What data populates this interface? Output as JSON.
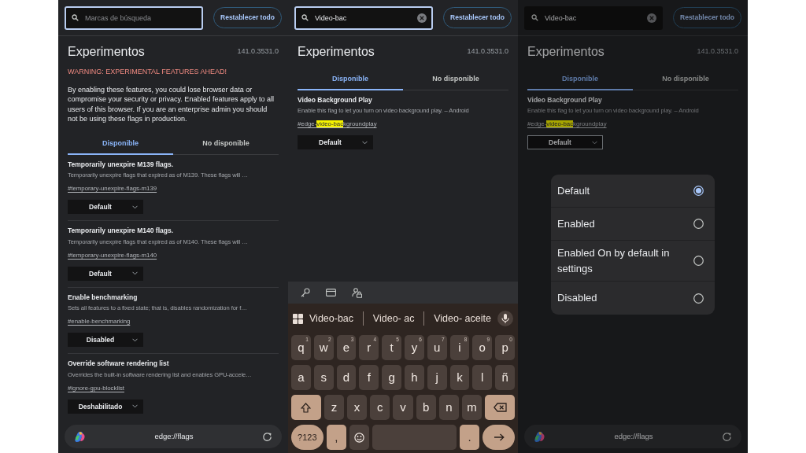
{
  "screens": [
    {
      "dimmed": false,
      "search": {
        "placeholder": "Marcas de búsqueda",
        "focused": true
      },
      "reset_button": "Restablecer todo",
      "title": "Experimentos",
      "version": "141.0.3531.0",
      "warning": "WARNING: EXPERIMENTAL FEATURES AHEAD!",
      "intro": "By enabling these features, you could lose browser data or compromise your security or privacy. Enabled features apply to all users of this browser. If you are an enterprise admin you should not be using these flags in production.",
      "tabs": [
        {
          "label": "Disponible",
          "selected": true
        },
        {
          "label": "No disponible",
          "selected": false
        }
      ],
      "flags": [
        {
          "name": "Temporarily unexpire M139 flags.",
          "description": "Temporarily unexpire flags that expired as of M139. These flags will …",
          "link": [
            {
              "text": "#temporary-unexpire-flags-m139",
              "highlighted": false
            }
          ],
          "value": "Default",
          "focused": false
        },
        {
          "name": "Temporarily unexpire M140 flags.",
          "description": "Temporarily unexpire flags that expired as of M140. These flags will …",
          "link": [
            {
              "text": "#temporary-unexpire-flags-m140",
              "highlighted": false
            }
          ],
          "value": "Default",
          "focused": false
        },
        {
          "name": "Enable benchmarking",
          "description": "Sets all features to a fixed state; that is, disables randomization for f…",
          "link": [
            {
              "text": "#enable-benchmarking",
              "highlighted": false
            }
          ],
          "value": "Disabled",
          "focused": false
        },
        {
          "name": "Override software rendering list",
          "description": "Overrides the built-in software rendering list and enables GPU-accele…",
          "link": [
            {
              "text": "#ignore-gpu-blocklist",
              "highlighted": false
            }
          ],
          "value": "Deshabilitado",
          "focused": false
        }
      ],
      "address_bar": {
        "url": "edge://flags"
      }
    },
    {
      "dimmed": false,
      "search": {
        "value": "Video-bac",
        "focused": true
      },
      "reset_button": "Restablecer todo",
      "title": "Experimentos",
      "version": "141.0.3531.0",
      "tabs": [
        {
          "label": "Disponible",
          "selected": true
        },
        {
          "label": "No disponible",
          "selected": false
        }
      ],
      "flags": [
        {
          "name": "Video Background Play",
          "description": "Enable this flag to let you turn on video background play. – Android",
          "link": [
            {
              "text": "#edge-",
              "highlighted": false
            },
            {
              "text": "video-bac",
              "highlighted": true
            },
            {
              "text": "kgroundplay",
              "highlighted": false
            }
          ],
          "value": "Default",
          "focused": false
        }
      ],
      "keyboard": {
        "suggestions": [
          "Video-bac",
          "Video- ac",
          "Video- aceite"
        ],
        "rows": [
          [
            {
              "kind": "letter",
              "label": "q",
              "hint": "1"
            },
            {
              "kind": "letter",
              "label": "w",
              "hint": "2"
            },
            {
              "kind": "letter",
              "label": "e",
              "hint": "3"
            },
            {
              "kind": "letter",
              "label": "r",
              "hint": "4"
            },
            {
              "kind": "letter",
              "label": "t",
              "hint": "5"
            },
            {
              "kind": "letter",
              "label": "y",
              "hint": "6"
            },
            {
              "kind": "letter",
              "label": "u",
              "hint": "7"
            },
            {
              "kind": "letter",
              "label": "i",
              "hint": "8"
            },
            {
              "kind": "letter",
              "label": "o",
              "hint": "9"
            },
            {
              "kind": "letter",
              "label": "p",
              "hint": "0"
            }
          ],
          [
            {
              "kind": "letter",
              "label": "a"
            },
            {
              "kind": "letter",
              "label": "s"
            },
            {
              "kind": "letter",
              "label": "d"
            },
            {
              "kind": "letter",
              "label": "f"
            },
            {
              "kind": "letter",
              "label": "g"
            },
            {
              "kind": "letter",
              "label": "h"
            },
            {
              "kind": "letter",
              "label": "j"
            },
            {
              "kind": "letter",
              "label": "k"
            },
            {
              "kind": "letter",
              "label": "l"
            },
            {
              "kind": "letter",
              "label": "ñ"
            }
          ],
          [
            {
              "kind": "shift"
            },
            {
              "kind": "letter",
              "label": "z"
            },
            {
              "kind": "letter",
              "label": "x"
            },
            {
              "kind": "letter",
              "label": "c"
            },
            {
              "kind": "letter",
              "label": "v"
            },
            {
              "kind": "letter",
              "label": "b"
            },
            {
              "kind": "letter",
              "label": "n"
            },
            {
              "kind": "letter",
              "label": "m"
            },
            {
              "kind": "backspace"
            }
          ],
          [
            {
              "kind": "symbols",
              "label": "?123"
            },
            {
              "kind": "punct",
              "label": ","
            },
            {
              "kind": "emoji"
            },
            {
              "kind": "space"
            },
            {
              "kind": "punct",
              "label": "."
            },
            {
              "kind": "enter"
            }
          ]
        ]
      }
    },
    {
      "dimmed": true,
      "search": {
        "value": "Video-bac",
        "focused": false
      },
      "reset_button": "Restablecer todo",
      "title": "Experimentos",
      "version": "141.0.3531.0",
      "tabs": [
        {
          "label": "Disponible",
          "selected": true
        },
        {
          "label": "No disponible",
          "selected": false
        }
      ],
      "flags": [
        {
          "name": "Video Background Play",
          "description": "Enable this flag to let you turn on video background play. – Android",
          "link": [
            {
              "text": "#edge-",
              "highlighted": false
            },
            {
              "text": "video-bac",
              "highlighted": true
            },
            {
              "text": "kgroundplay",
              "highlighted": false
            }
          ],
          "value": "Default",
          "focused": true
        }
      ],
      "dialog": {
        "options": [
          {
            "label": "Default",
            "selected": true
          },
          {
            "label": "Enabled",
            "selected": false
          },
          {
            "label": "Enabled On by default in settings",
            "selected": false
          },
          {
            "label": "Disabled",
            "selected": false
          }
        ]
      },
      "address_bar": {
        "url": "edge://flags"
      }
    }
  ]
}
